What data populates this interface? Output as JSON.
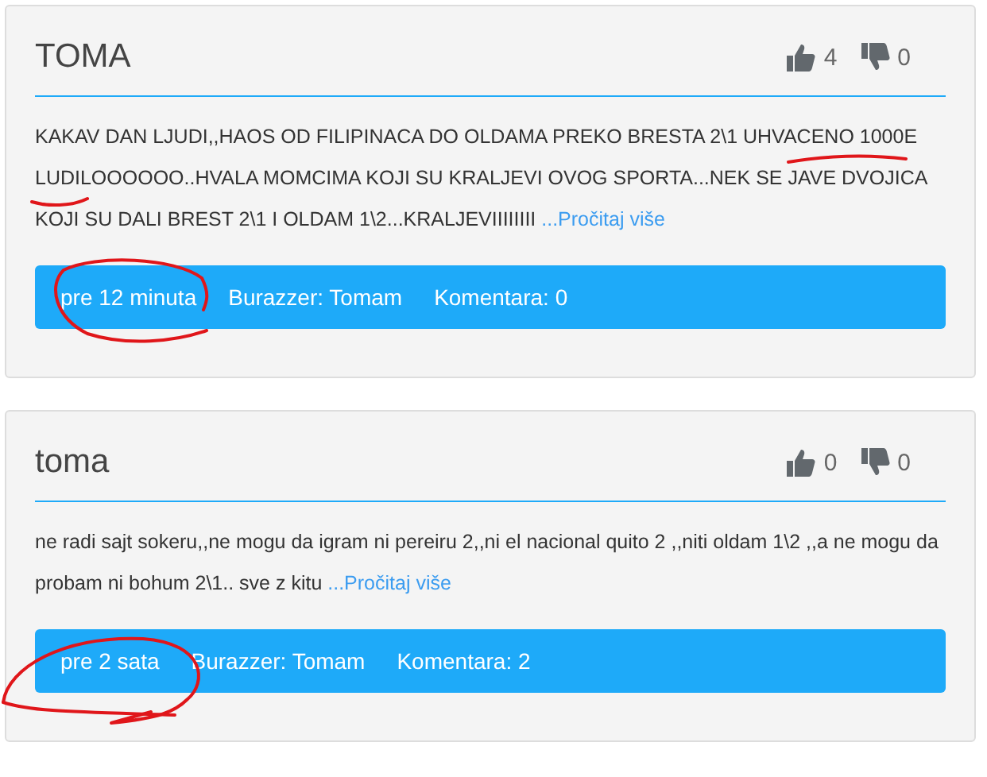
{
  "posts": [
    {
      "title": "TOMA",
      "likes": "4",
      "dislikes": "0",
      "body": "KAKAV DAN LJUDI,,HAOS OD FILIPINACA DO OLDAMA PREKO BRESTA 2\\1 UHVACENO 1000E LUDILOOOOOO..HVALA MOMCIMA KOJI SU KRALJEVI OVOG SPORTA...NEK SE JAVE DVOJICA KOJI SU DALI BREST 2\\1 I OLDAM 1\\2...KRALJEVIIIIIIII",
      "more": "...Pročitaj više",
      "time": "pre 12 minuta",
      "author": "Burazzer: Tomam",
      "comments": "Komentara: 0"
    },
    {
      "title": "toma",
      "likes": "0",
      "dislikes": "0",
      "body": "ne radi sajt sokeru,,ne mogu da igram ni pereiru 2,,ni el nacional quito 2 ,,niti oldam 1\\2 ,,a ne mogu da probam ni bohum 2\\1.. sve z kitu",
      "more": "...Pročitaj više",
      "time": "pre 2 sata",
      "author": "Burazzer: Tomam",
      "comments": "Komentara: 2"
    }
  ]
}
